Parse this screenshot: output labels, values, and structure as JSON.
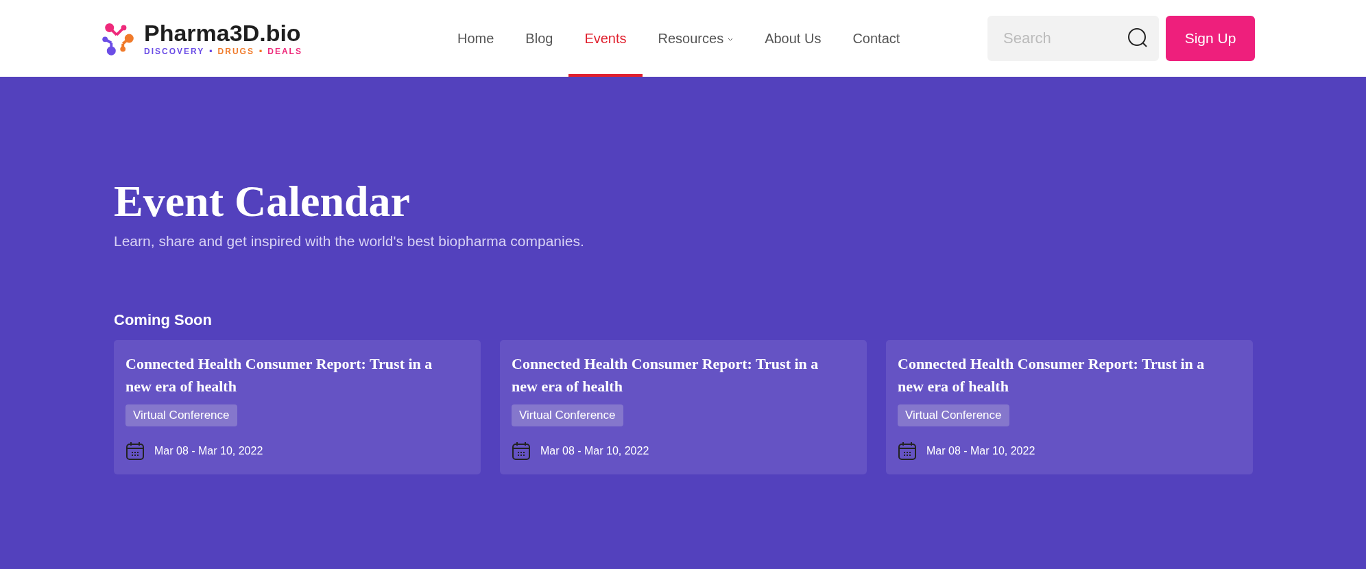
{
  "header": {
    "logo": {
      "name": "Pharma3D.bio",
      "tagline": [
        {
          "text": "DISCOVERY",
          "color": "#6b4de6"
        },
        {
          "text": "·",
          "color": "#6b4de6"
        },
        {
          "text": "DRUGS",
          "color": "#f07a2a"
        },
        {
          "text": "·",
          "color": "#f07a2a"
        },
        {
          "text": "DEALS",
          "color": "#ee2a7b"
        }
      ]
    },
    "nav": [
      {
        "label": "Home",
        "selected": false,
        "has_menu": false
      },
      {
        "label": "Blog",
        "selected": false,
        "has_menu": false
      },
      {
        "label": "Events",
        "selected": true,
        "has_menu": false
      },
      {
        "label": "Resources",
        "selected": false,
        "has_menu": true
      },
      {
        "label": "About Us",
        "selected": false,
        "has_menu": false
      },
      {
        "label": "Contact",
        "selected": false,
        "has_menu": false
      }
    ],
    "search": {
      "placeholder": "Search"
    },
    "signup": "Sign Up"
  },
  "hero": {
    "title": "Event Calendar",
    "subtitle": "Learn, share and get inspired with the world's best biopharma companies."
  },
  "section": {
    "heading": "Coming Soon",
    "events": [
      {
        "title": "Connected Health Consumer Report: Trust in a new era of health",
        "tag": "Virtual Conference",
        "date": "Mar 08 - Mar 10, 2022"
      },
      {
        "title": "Connected Health Consumer Report: Trust in a new era of health",
        "tag": "Virtual Conference",
        "date": "Mar 08 - Mar 10, 2022"
      },
      {
        "title": "Connected Health Consumer Report: Trust in a new era of health",
        "tag": "Virtual Conference",
        "date": "Mar 08 - Mar 10, 2022"
      }
    ]
  }
}
